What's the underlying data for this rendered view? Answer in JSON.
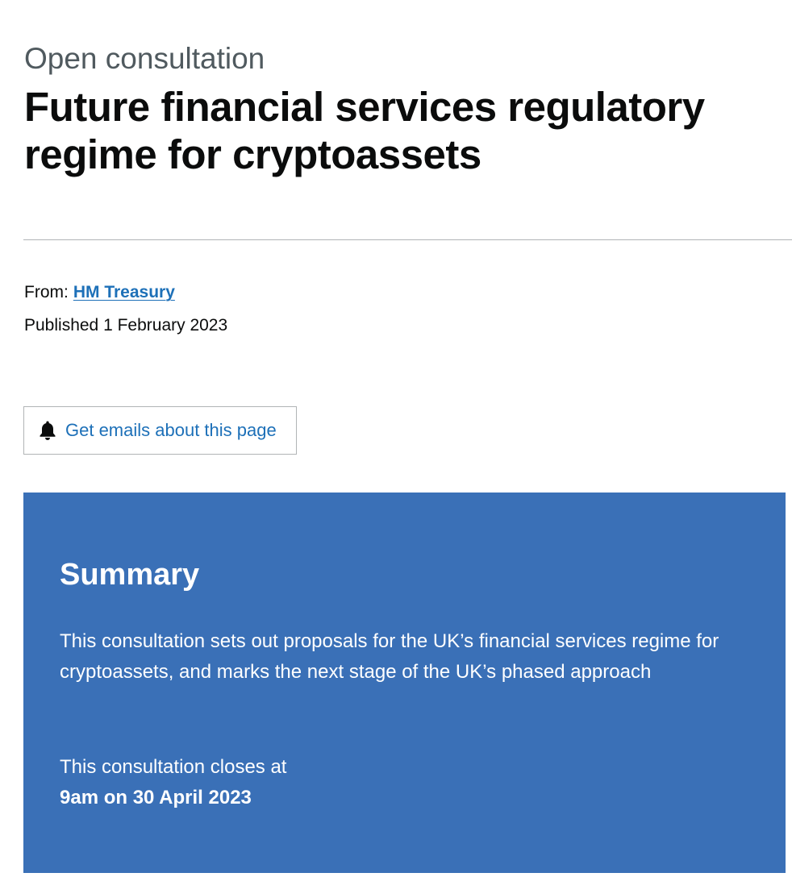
{
  "header": {
    "caption": "Open consultation",
    "title": "Future financial services regulatory regime for cryptoassets"
  },
  "meta": {
    "from_label": "From:",
    "from_link": "HM Treasury",
    "published": "Published 1 February 2023"
  },
  "email_button": {
    "label": "Get emails about this page",
    "icon": "bell-icon"
  },
  "summary": {
    "heading": "Summary",
    "text": "This consultation sets out proposals for the UK’s financial services regime for cryptoassets, and marks the next stage of the UK’s phased approach",
    "closes_label": "This consultation closes at",
    "closes_date": "9am on 30 April 2023"
  },
  "colors": {
    "link": "#1d70b8",
    "summary_background": "#3a70b7",
    "divider": "#b1b4b6"
  }
}
